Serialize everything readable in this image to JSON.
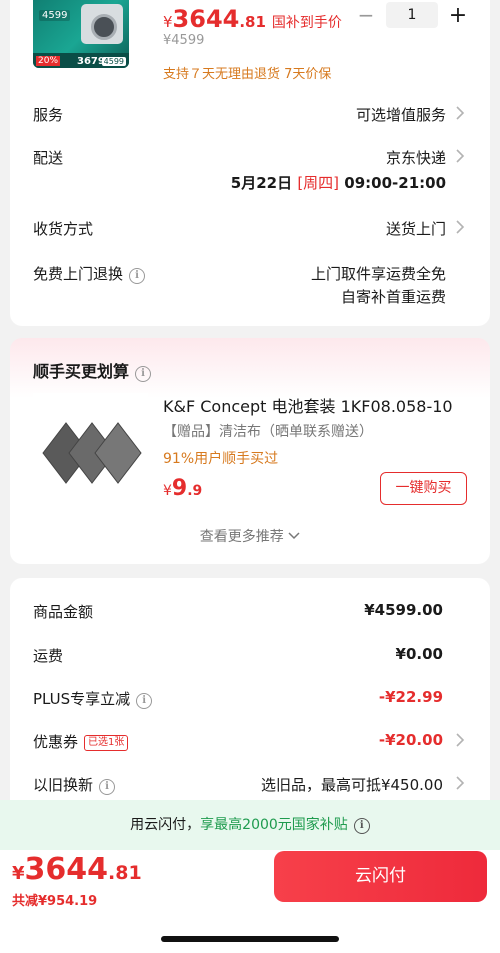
{
  "product": {
    "thumb": {
      "badge": "4599",
      "promo": "20%",
      "price": "3679",
      "tag": "4599"
    },
    "price_yen": "¥",
    "price_int": "3644",
    "price_dec": ".81",
    "subsidy_tag": "国补到手价",
    "original_price": "¥4599",
    "service_tip": "支持７天无理由退货  7天价保",
    "quantity": "1",
    "minus": "−",
    "plus": "+"
  },
  "details": {
    "service": {
      "label": "服务",
      "value": "可选增值服务"
    },
    "delivery": {
      "label": "配送",
      "value": "京东快递",
      "date": "5月22日",
      "weekday": "[周四]",
      "time": "09:00-21:00"
    },
    "receive": {
      "label": "收货方式",
      "value": "送货上门"
    },
    "returns": {
      "label": "免费上门退换",
      "value_line1": "上门取件享运费全免",
      "value_line2": "自寄补首重运费"
    }
  },
  "recommend": {
    "title": "顺手买更划算",
    "name": "K&F Concept 电池套装 1KF08.058-10",
    "gift": "【赠品】清洁布（晒单联系赠送）",
    "percent": "91%用户顺手买过",
    "price_yen": "¥",
    "price_int": "9",
    "price_dec": ".9",
    "buy_label": "一键购买",
    "more_label": "查看更多推荐"
  },
  "summary": {
    "amount": {
      "label": "商品金额",
      "value": "¥4599.00"
    },
    "shipping": {
      "label": "运费",
      "value": "¥0.00"
    },
    "plus": {
      "label": "PLUS专享立减",
      "value": "-¥22.99"
    },
    "coupon": {
      "label": "优惠券",
      "tag": "已选1张",
      "value": "-¥20.00"
    },
    "tradein": {
      "label": "以旧换新",
      "value": "选旧品，最高可抵¥450.00"
    }
  },
  "banner": {
    "prefix": "用云闪付，",
    "highlight": "享最高2000元国家补贴"
  },
  "footer": {
    "price_yen": "¥",
    "price_int": "3644",
    "price_dec": ".81",
    "saved": "共减¥954.19",
    "pay_label": "云闪付"
  },
  "colors": {
    "accent": "#e52d2d",
    "orange": "#d77a1f",
    "green": "#1e9b4e"
  }
}
